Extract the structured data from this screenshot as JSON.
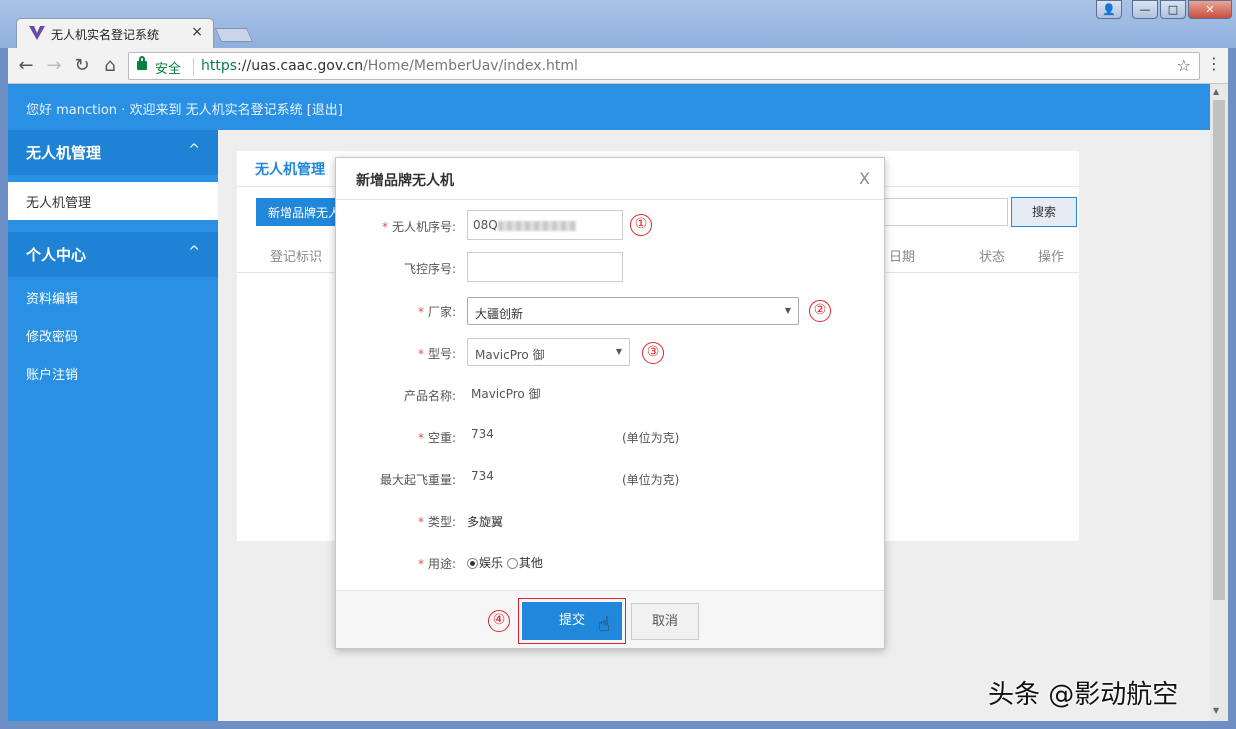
{
  "browser": {
    "tab_title": "无人机实名登记系统",
    "tab_close": "×",
    "secure_label": "安全",
    "url_proto": "https",
    "url_host": "://uas.caac.gov.cn",
    "url_path": "/Home/MemberUav/index.html",
    "back": "←",
    "forward": "→",
    "reload": "↻",
    "home": "⌂",
    "star": "☆",
    "menu": "⋮",
    "win_min": "—",
    "win_max": "□",
    "win_close": "✕",
    "win_user": "👤"
  },
  "header": {
    "greeting": "您好 manction · 欢迎来到 无人机实名登记系统 [退出]"
  },
  "sidebar": {
    "section1": "无人机管理",
    "section1_item": "无人机管理",
    "section2": "个人中心",
    "items": [
      "资料编辑",
      "修改密码",
      "账户注销"
    ],
    "chevron": "^"
  },
  "panel": {
    "title": "无人机管理",
    "new_button": "新增品牌无人",
    "search_button": "搜索",
    "columns": [
      "登记标识",
      "日期",
      "状态",
      "操作"
    ]
  },
  "modal": {
    "title": "新增品牌无人机",
    "close": "X",
    "req_mark": "*",
    "serial_label": "无人机序号:",
    "serial_value": "08Q",
    "fc_label": "飞控序号:",
    "fc_value": "",
    "maker_label": "厂家:",
    "maker_value": "大疆创新",
    "model_label": "型号:",
    "model_value": "MavicPro 御",
    "product_label": "产品名称:",
    "product_value": "MavicPro 御",
    "weight_label": "空重:",
    "weight_value": "734",
    "weight_unit": "(单位为克)",
    "maxweight_label": "最大起飞重量:",
    "maxweight_value": "734",
    "maxweight_unit": "(单位为克)",
    "type_label": "类型:",
    "type_value": "多旋翼",
    "usage_label": "用途:",
    "usage_options": [
      "娱乐",
      "其他"
    ],
    "usage_selected": "娱乐",
    "submit": "提交",
    "cancel": "取消"
  },
  "markers": [
    "①",
    "②",
    "③",
    "④"
  ],
  "watermark": "头条 @影动航空",
  "colors": {
    "primary_blue": "#2990e4",
    "button_blue": "#2187db",
    "marker_red": "#e0262c"
  }
}
